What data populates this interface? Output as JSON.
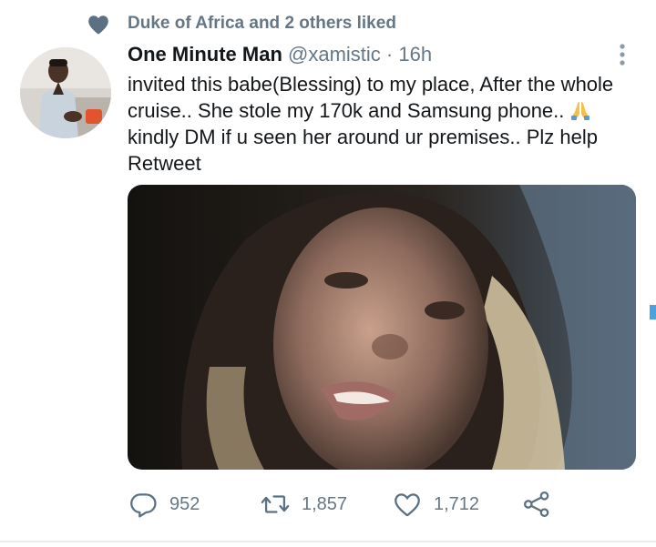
{
  "social_context": {
    "text": "Duke of Africa and 2 others liked",
    "icon": "heart-icon"
  },
  "tweet": {
    "author_name": "One Minute Man",
    "handle": "@xamistic",
    "separator": " · ",
    "time": "16h",
    "lines": [
      "invited this babe(Blessing) to my place, After the whole",
      "cruise.. She stole my 170k and Samsung phone..",
      "kindly DM if u seen her around ur premises.. Plz help",
      "Retweet"
    ],
    "emoji": "folded-hands-emoji"
  },
  "actions": {
    "reply_count": "952",
    "retweet_count": "1,857",
    "like_count": "1,712"
  },
  "colors": {
    "secondary_text": "#657786",
    "primary_text": "#14171a",
    "icon": "#5b7083",
    "divider": "#e6ecf0"
  }
}
